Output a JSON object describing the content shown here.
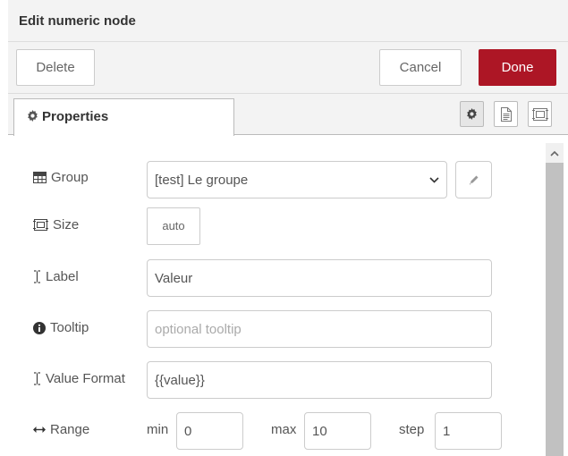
{
  "tray": {
    "title": "Edit numeric node"
  },
  "toolbar": {
    "delete_label": "Delete",
    "cancel_label": "Cancel",
    "done_label": "Done",
    "done_color": "#ad1625"
  },
  "tabs": {
    "properties_label": "Properties",
    "icons": [
      "gear-icon",
      "description-icon",
      "appearance-icon"
    ]
  },
  "form": {
    "group": {
      "label": "Group",
      "value": "[test] Le groupe"
    },
    "size": {
      "label": "Size",
      "value": "auto"
    },
    "label": {
      "label": "Label",
      "value": "Valeur"
    },
    "tooltip": {
      "label": "Tooltip",
      "placeholder": "optional tooltip"
    },
    "format": {
      "label": "Value Format",
      "value": "{{value}}"
    },
    "range": {
      "label": "Range",
      "min_label": "min",
      "min": "0",
      "max_label": "max",
      "max": "10",
      "step_label": "step",
      "step": "1"
    }
  }
}
